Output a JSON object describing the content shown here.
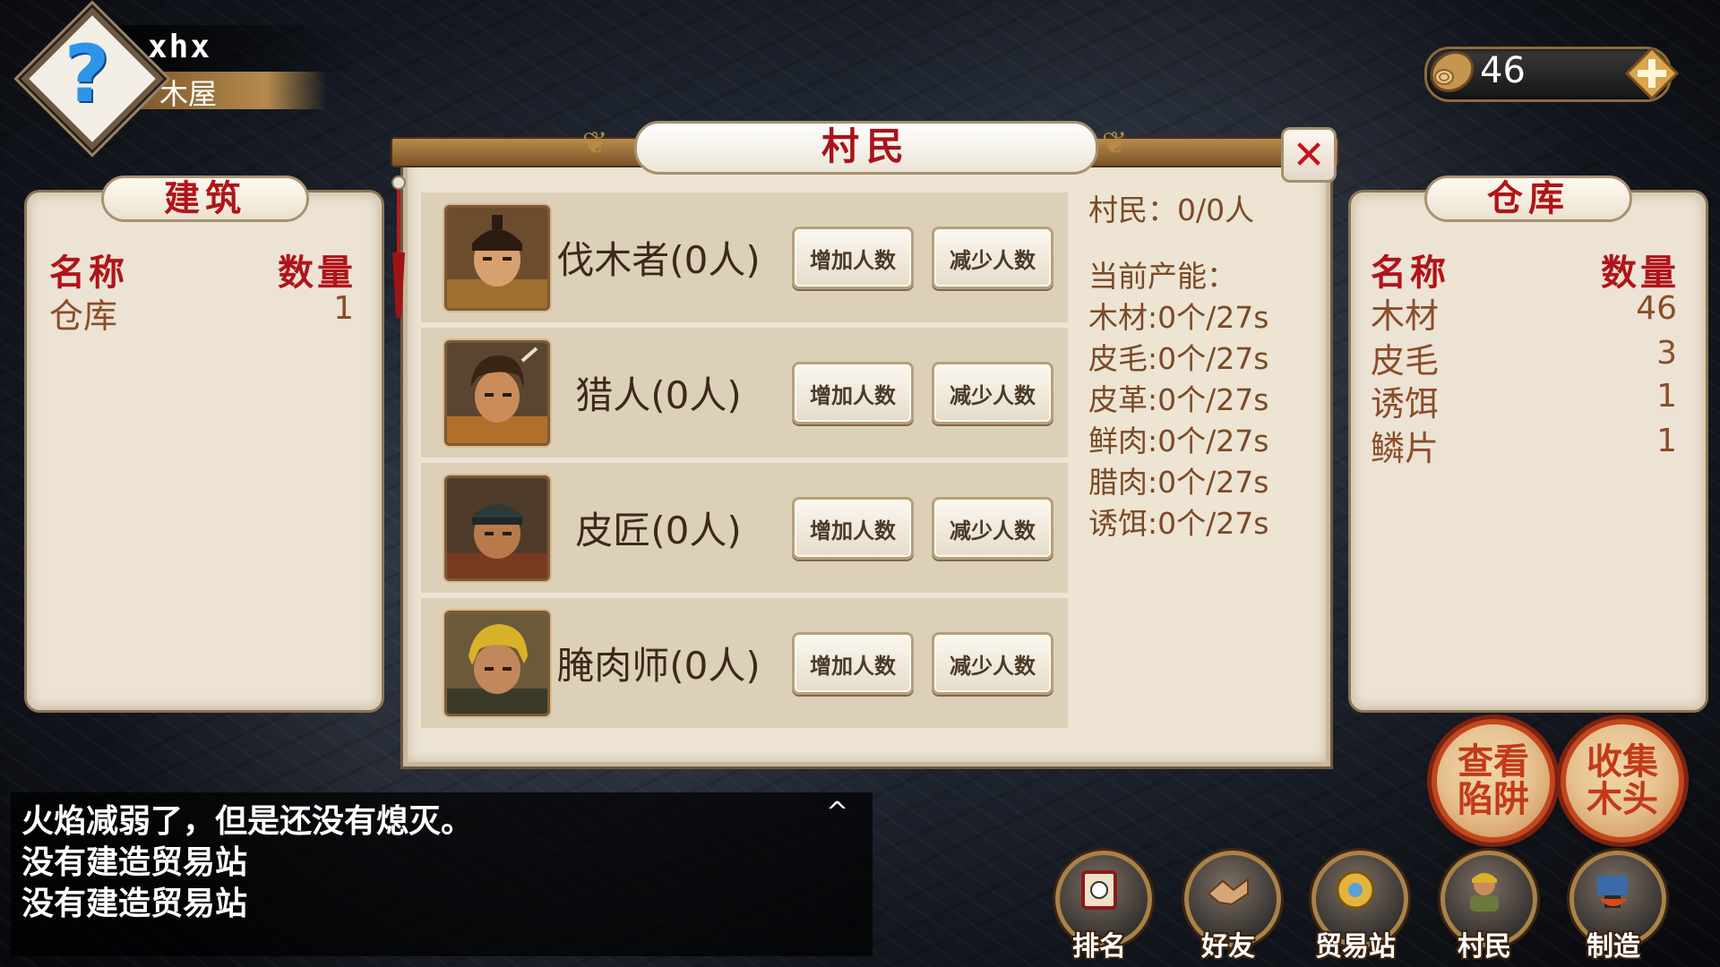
{
  "player": {
    "name": "xhx",
    "building": "木屋",
    "avatar_icon": "question-mark-icon"
  },
  "resources": {
    "wood_count": "46",
    "wood_icon": "wood-log-icon",
    "plus_icon": "plus-icon"
  },
  "buildings_panel": {
    "title": "建筑",
    "col_name": "名称",
    "col_qty": "数量",
    "items": [
      {
        "name": "仓库",
        "qty": "1"
      }
    ]
  },
  "storage_panel": {
    "title": "仓库",
    "col_name": "名称",
    "col_qty": "数量",
    "items": [
      {
        "name": "木材",
        "qty": "46"
      },
      {
        "name": "皮毛",
        "qty": "3"
      },
      {
        "name": "诱饵",
        "qty": "1"
      },
      {
        "name": "鳞片",
        "qty": "1"
      }
    ]
  },
  "dialog": {
    "title": "村民",
    "close_icon": "close-icon",
    "villagers": [
      {
        "label": "伐木者(0人)",
        "add": "增加人数",
        "sub": "减少人数"
      },
      {
        "label": "猎人(0人)",
        "add": "增加人数",
        "sub": "减少人数"
      },
      {
        "label": "皮匠(0人)",
        "add": "增加人数",
        "sub": "减少人数"
      },
      {
        "label": "腌肉师(0人)",
        "add": "增加人数",
        "sub": "减少人数"
      }
    ],
    "summary": "村民：0/0人",
    "capacity_title": "当前产能：",
    "capacity": [
      "木材:0个/27s",
      "皮毛:0个/27s",
      "皮革:0个/27s",
      "鲜肉:0个/27s",
      "腊肉:0个/27s",
      "诱饵:0个/27s"
    ]
  },
  "log": {
    "lines": [
      "火焰减弱了，但是还没有熄灭。",
      "没有建造贸易站",
      "没有建造贸易站"
    ],
    "toggle": "^"
  },
  "actions": {
    "check_traps": "查看\n陷阱",
    "collect_wood": "收集\n木头"
  },
  "menu": [
    {
      "label": "排名",
      "icon": "ranking-scroll-icon"
    },
    {
      "label": "好友",
      "icon": "handshake-icon"
    },
    {
      "label": "贸易站",
      "icon": "trade-coin-icon"
    },
    {
      "label": "村民",
      "icon": "villager-icon"
    },
    {
      "label": "制造",
      "icon": "anvil-icon"
    }
  ]
}
